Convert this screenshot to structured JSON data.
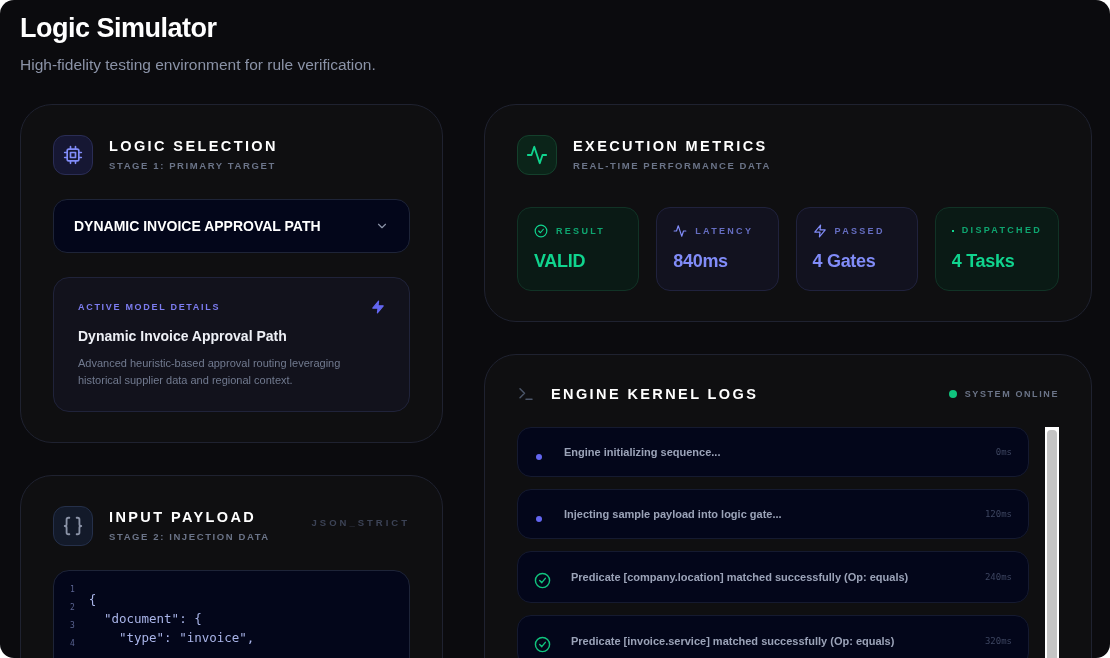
{
  "header": {
    "title": "Logic Simulator",
    "subtitle": "High-fidelity testing environment for rule verification."
  },
  "logic_selection": {
    "title": "LOGIC SELECTION",
    "subtitle": "STAGE 1: PRIMARY TARGET",
    "select_value": "DYNAMIC INVOICE APPROVAL PATH",
    "details": {
      "label": "ACTIVE MODEL DETAILS",
      "name": "Dynamic Invoice Approval Path",
      "description": "Advanced heuristic-based approval routing leveraging historical supplier data and regional context."
    }
  },
  "input_payload": {
    "title": "INPUT PAYLOAD",
    "subtitle": "STAGE 2: INJECTION DATA",
    "format": "JSON_STRICT",
    "line_numbers": [
      "1",
      "2",
      "3",
      "4"
    ],
    "code_lines": [
      "{",
      "  \"document\": {",
      "    \"type\": \"invoice\","
    ]
  },
  "execution_metrics": {
    "title": "EXECUTION METRICS",
    "subtitle": "REAL-TIME PERFORMANCE DATA",
    "metrics": [
      {
        "kind": "check",
        "label": "RESULT",
        "value": "VALID",
        "color": "#10d48e"
      },
      {
        "kind": "pulse",
        "label": "LATENCY",
        "value": "840ms",
        "color": "#818cf8"
      },
      {
        "kind": "bolt",
        "label": "PASSED",
        "value": "4 Gates",
        "color": "#818cf8"
      },
      {
        "kind": "dot",
        "label": "DISPATCHED",
        "value": "4 Tasks",
        "color": "#10d48e"
      }
    ]
  },
  "logs": {
    "title": "ENGINE KERNEL LOGS",
    "status": "SYSTEM ONLINE",
    "entries": [
      {
        "kind": "pending",
        "message": "Engine initializing sequence...",
        "time": "0ms"
      },
      {
        "kind": "pending",
        "message": "Injecting sample payload into logic gate...",
        "time": "120ms"
      },
      {
        "kind": "success",
        "message": "Predicate [company.location] matched successfully (Op: equals)",
        "time": "240ms"
      },
      {
        "kind": "success",
        "message": "Predicate [invoice.service] matched successfully (Op: equals)",
        "time": "320ms"
      }
    ]
  }
}
